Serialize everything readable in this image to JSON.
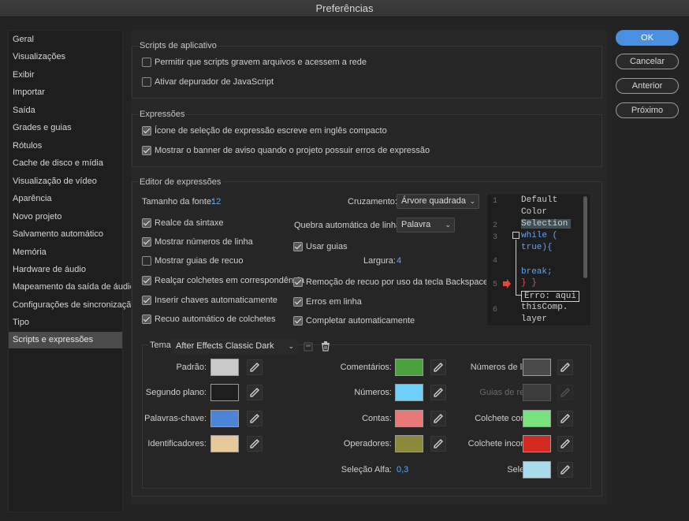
{
  "window": {
    "title": "Preferências"
  },
  "sidebar": {
    "items": [
      {
        "label": "Geral"
      },
      {
        "label": "Visualizações"
      },
      {
        "label": "Exibir"
      },
      {
        "label": "Importar"
      },
      {
        "label": "Saída"
      },
      {
        "label": "Grades e guias"
      },
      {
        "label": "Rótulos"
      },
      {
        "label": "Cache de disco e mídia"
      },
      {
        "label": "Visualização de vídeo"
      },
      {
        "label": "Aparência"
      },
      {
        "label": "Novo projeto"
      },
      {
        "label": "Salvamento automático"
      },
      {
        "label": "Memória"
      },
      {
        "label": "Hardware de áudio"
      },
      {
        "label": "Mapeamento da saída de áudio"
      },
      {
        "label": "Configurações de sincronização"
      },
      {
        "label": "Tipo"
      },
      {
        "label": "Scripts e expressões"
      }
    ],
    "selected": "Scripts e expressões"
  },
  "buttons": {
    "ok": "OK",
    "cancel": "Cancelar",
    "previous": "Anterior",
    "next": "Próximo"
  },
  "scripts": {
    "title": "Scripts de aplicativo",
    "allow_write": {
      "label": "Permitir que scripts gravem arquivos e acessem a rede",
      "checked": false
    },
    "js_debugger": {
      "label": "Ativar depurador de JavaScript",
      "checked": false
    }
  },
  "expressions": {
    "title": "Expressões",
    "pick_whip": {
      "label": "Ícone de seleção de expressão escreve em inglês compacto",
      "checked": true
    },
    "warning_banner": {
      "label": "Mostrar o banner de aviso quando o projeto possuir erros de expressão",
      "checked": true
    }
  },
  "editor": {
    "title": "Editor de expressões",
    "font_size_label": "Tamanho da fonte:",
    "font_size_value": "12",
    "crossing_label": "Cruzamento:",
    "crossing_value": "Árvore quadrada",
    "wrap_label": "Quebra automática de linha:",
    "wrap_value": "Palavra",
    "use_guides": {
      "label": "Usar guias",
      "checked": true
    },
    "width_label": "Largura:",
    "width_value": "4",
    "left_options": [
      {
        "label": "Realce da sintaxe",
        "checked": true
      },
      {
        "label": "Mostrar números de linha",
        "checked": true
      },
      {
        "label": "Mostrar guias de recuo",
        "checked": false
      },
      {
        "label": "Realçar colchetes em correspondência",
        "checked": true
      },
      {
        "label": "Inserir chaves automaticamente",
        "checked": true
      },
      {
        "label": "Recuo automático de colchetes",
        "checked": true
      }
    ],
    "right_options": [
      {
        "label": "Remoção de recuo por uso da tecla Backspace",
        "checked": true
      },
      {
        "label": "Erros em linha",
        "checked": true
      },
      {
        "label": "Completar automaticamente",
        "checked": true
      }
    ]
  },
  "preview": {
    "line_numbers": [
      "1",
      "2",
      "3",
      "4",
      "5",
      "6"
    ],
    "lines": [
      "Default",
      "Color",
      "Selection",
      "while (",
      "true){",
      "break;",
      "} }",
      "Erro: aqui",
      "thisComp.",
      "layer"
    ]
  },
  "theme": {
    "label": "Tema:",
    "value": "After Effects Classic Dark",
    "colors": [
      {
        "label": "Padrão:",
        "color": "#c9c9c9"
      },
      {
        "label": "Segundo plano:",
        "color": "#1e1e1e"
      },
      {
        "label": "Palavras-chave:",
        "color": "#4a85d8"
      },
      {
        "label": "Identificadores:",
        "color": "#e5c99a"
      },
      {
        "label": "Comentários:",
        "color": "#4ba13d"
      },
      {
        "label": "Números:",
        "color": "#6fd0f7"
      },
      {
        "label": "Contas:",
        "color": "#e87878"
      },
      {
        "label": "Operadores:",
        "color": "#8a8a3a"
      },
      {
        "label": "Números de linha:",
        "color": "#4a4a4a"
      },
      {
        "label": "Guias de recuo:",
        "color": "#3c3c3c"
      },
      {
        "label": "Colchete correto:",
        "color": "#78e27f"
      },
      {
        "label": "Colchete incorreto:",
        "color": "#d42a22"
      },
      {
        "label": "Seleção:",
        "color": "#a9dbea"
      }
    ],
    "alpha_label": "Seleção Alfa:",
    "alpha_value": "0,3"
  }
}
